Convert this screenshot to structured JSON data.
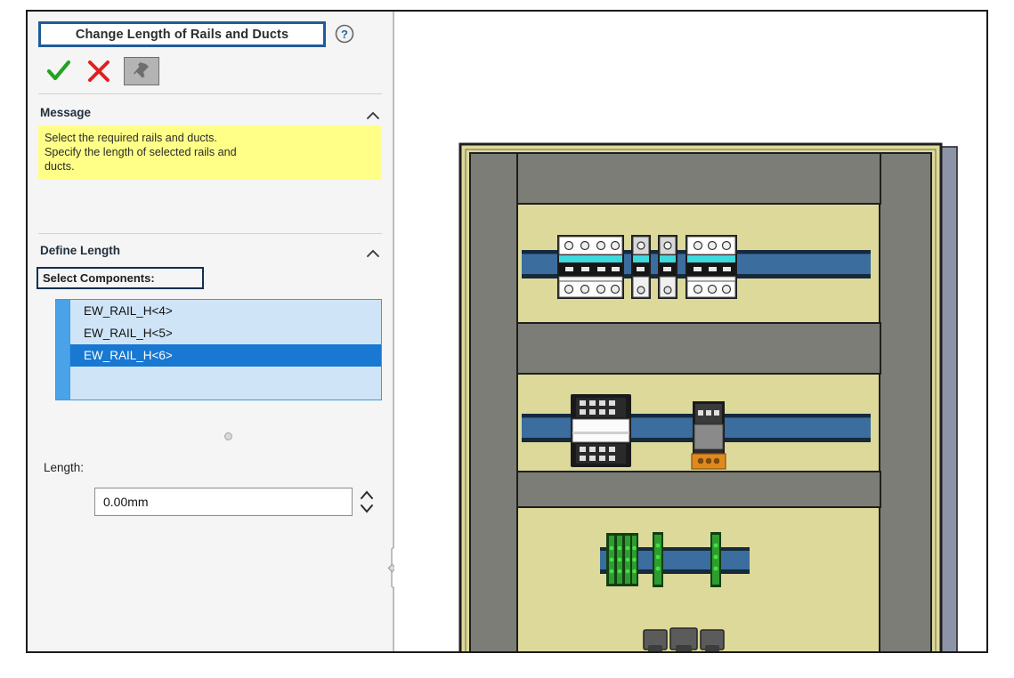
{
  "window": {
    "title": "Change Length of Rails and Ducts"
  },
  "panel": {
    "title": "Change Length of Rails and Ducts",
    "help_icon": "help-question-icon",
    "buttons": {
      "ok_label": "✓",
      "ok_name": "checkmark-icon",
      "cancel_label": "✕",
      "cancel_name": "cross-icon",
      "pin_name": "pushpin-icon"
    },
    "message_section": {
      "header": "Message",
      "collapse_icon": "chevron-up-icon",
      "lines": [
        "Select the required rails and ducts.",
        "Specify the length of selected rails and",
        "ducts."
      ],
      "background": "#ffff88"
    },
    "define_length_section": {
      "header": "Define Length",
      "collapse_icon": "chevron-up-icon",
      "select_components_label": "Select Components:",
      "components": [
        {
          "label": "EW_RAIL_H<4>",
          "selected": false
        },
        {
          "label": "EW_RAIL_H<5>",
          "selected": false
        },
        {
          "label": "EW_RAIL_H<6>",
          "selected": true
        }
      ],
      "length_label": "Length:",
      "length_value": "0.00mm",
      "length_placeholder": "0.00mm",
      "spinner_up_icon": "chevron-up-icon",
      "spinner_down_icon": "chevron-down-icon"
    },
    "colors": {
      "title_border": "#1f5c99",
      "field_border": "#10304f",
      "list_background": "#cfe5f7",
      "list_selected": "#1878d2",
      "message_background": "#ffff88"
    }
  },
  "viewport": {
    "name": "3d-model-viewport",
    "model": "electrical-enclosure-backplate",
    "colors": {
      "backplate": "#dcd99b",
      "duct": "#7d7d78",
      "rail": "#3b6d9e",
      "rail_dark": "#1e3d5c",
      "breaker_body": "#ffffff",
      "breaker_band": "#3fd8dd",
      "contactor": "#f2f2f2",
      "relay": "#8a8a8a",
      "relay_base": "#e08a1e",
      "terminal_green": "#2f9c2f",
      "enclosure_edge": "#8e94a8"
    },
    "rows": [
      {
        "name": "top-rail-row",
        "rail": "EW_RAIL_H<4>",
        "components": [
          "breaker-4pole",
          "breaker-1pole",
          "breaker-1pole",
          "breaker-3pole"
        ]
      },
      {
        "name": "middle-rail-row",
        "rail": "EW_RAIL_H<5>",
        "components": [
          "contactor",
          "relay-with-socket"
        ]
      },
      {
        "name": "bottom-rail-row",
        "rail": "EW_RAIL_H<6>",
        "components": [
          "terminal-block-group",
          "end-stop",
          "end-stop"
        ]
      }
    ],
    "bottom_components": [
      "cable-gland",
      "cable-gland",
      "cable-gland"
    ]
  }
}
